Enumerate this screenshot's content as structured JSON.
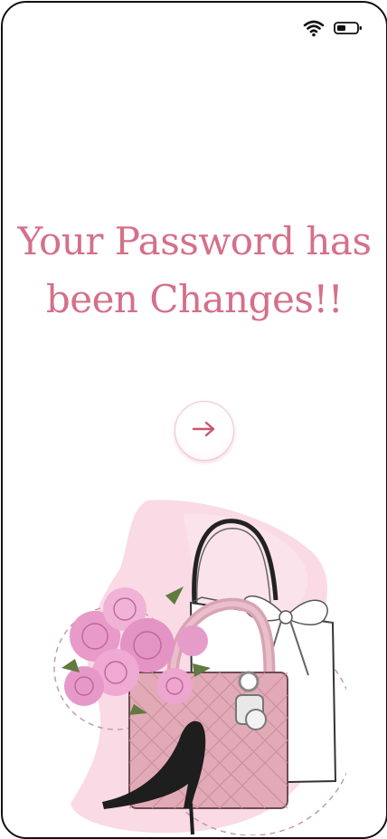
{
  "status_bar": {
    "wifi_icon": "wifi-icon",
    "battery_icon": "battery-icon"
  },
  "main": {
    "title_line1": "Your Password has",
    "title_line2": "been Changes!!",
    "next_icon": "arrow-right-icon"
  },
  "colors": {
    "accent": "#d4708a",
    "button_border": "#efc6cf"
  }
}
